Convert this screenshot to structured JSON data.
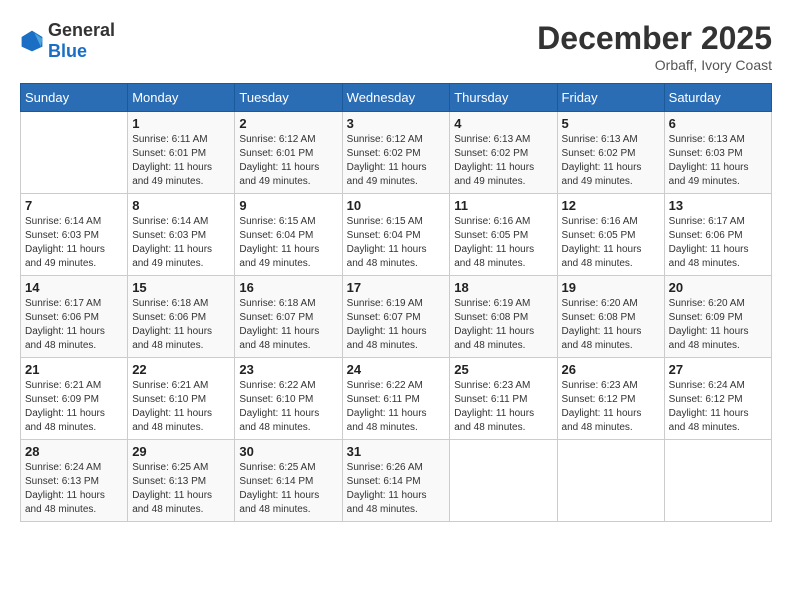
{
  "header": {
    "logo_general": "General",
    "logo_blue": "Blue",
    "month_title": "December 2025",
    "location": "Orbaff, Ivory Coast"
  },
  "days_of_week": [
    "Sunday",
    "Monday",
    "Tuesday",
    "Wednesday",
    "Thursday",
    "Friday",
    "Saturday"
  ],
  "weeks": [
    [
      {
        "day": "",
        "sunrise": "",
        "sunset": "",
        "daylight": ""
      },
      {
        "day": "1",
        "sunrise": "Sunrise: 6:11 AM",
        "sunset": "Sunset: 6:01 PM",
        "daylight": "Daylight: 11 hours and 49 minutes."
      },
      {
        "day": "2",
        "sunrise": "Sunrise: 6:12 AM",
        "sunset": "Sunset: 6:01 PM",
        "daylight": "Daylight: 11 hours and 49 minutes."
      },
      {
        "day": "3",
        "sunrise": "Sunrise: 6:12 AM",
        "sunset": "Sunset: 6:02 PM",
        "daylight": "Daylight: 11 hours and 49 minutes."
      },
      {
        "day": "4",
        "sunrise": "Sunrise: 6:13 AM",
        "sunset": "Sunset: 6:02 PM",
        "daylight": "Daylight: 11 hours and 49 minutes."
      },
      {
        "day": "5",
        "sunrise": "Sunrise: 6:13 AM",
        "sunset": "Sunset: 6:02 PM",
        "daylight": "Daylight: 11 hours and 49 minutes."
      },
      {
        "day": "6",
        "sunrise": "Sunrise: 6:13 AM",
        "sunset": "Sunset: 6:03 PM",
        "daylight": "Daylight: 11 hours and 49 minutes."
      }
    ],
    [
      {
        "day": "7",
        "sunrise": "Sunrise: 6:14 AM",
        "sunset": "Sunset: 6:03 PM",
        "daylight": "Daylight: 11 hours and 49 minutes."
      },
      {
        "day": "8",
        "sunrise": "Sunrise: 6:14 AM",
        "sunset": "Sunset: 6:03 PM",
        "daylight": "Daylight: 11 hours and 49 minutes."
      },
      {
        "day": "9",
        "sunrise": "Sunrise: 6:15 AM",
        "sunset": "Sunset: 6:04 PM",
        "daylight": "Daylight: 11 hours and 49 minutes."
      },
      {
        "day": "10",
        "sunrise": "Sunrise: 6:15 AM",
        "sunset": "Sunset: 6:04 PM",
        "daylight": "Daylight: 11 hours and 48 minutes."
      },
      {
        "day": "11",
        "sunrise": "Sunrise: 6:16 AM",
        "sunset": "Sunset: 6:05 PM",
        "daylight": "Daylight: 11 hours and 48 minutes."
      },
      {
        "day": "12",
        "sunrise": "Sunrise: 6:16 AM",
        "sunset": "Sunset: 6:05 PM",
        "daylight": "Daylight: 11 hours and 48 minutes."
      },
      {
        "day": "13",
        "sunrise": "Sunrise: 6:17 AM",
        "sunset": "Sunset: 6:06 PM",
        "daylight": "Daylight: 11 hours and 48 minutes."
      }
    ],
    [
      {
        "day": "14",
        "sunrise": "Sunrise: 6:17 AM",
        "sunset": "Sunset: 6:06 PM",
        "daylight": "Daylight: 11 hours and 48 minutes."
      },
      {
        "day": "15",
        "sunrise": "Sunrise: 6:18 AM",
        "sunset": "Sunset: 6:06 PM",
        "daylight": "Daylight: 11 hours and 48 minutes."
      },
      {
        "day": "16",
        "sunrise": "Sunrise: 6:18 AM",
        "sunset": "Sunset: 6:07 PM",
        "daylight": "Daylight: 11 hours and 48 minutes."
      },
      {
        "day": "17",
        "sunrise": "Sunrise: 6:19 AM",
        "sunset": "Sunset: 6:07 PM",
        "daylight": "Daylight: 11 hours and 48 minutes."
      },
      {
        "day": "18",
        "sunrise": "Sunrise: 6:19 AM",
        "sunset": "Sunset: 6:08 PM",
        "daylight": "Daylight: 11 hours and 48 minutes."
      },
      {
        "day": "19",
        "sunrise": "Sunrise: 6:20 AM",
        "sunset": "Sunset: 6:08 PM",
        "daylight": "Daylight: 11 hours and 48 minutes."
      },
      {
        "day": "20",
        "sunrise": "Sunrise: 6:20 AM",
        "sunset": "Sunset: 6:09 PM",
        "daylight": "Daylight: 11 hours and 48 minutes."
      }
    ],
    [
      {
        "day": "21",
        "sunrise": "Sunrise: 6:21 AM",
        "sunset": "Sunset: 6:09 PM",
        "daylight": "Daylight: 11 hours and 48 minutes."
      },
      {
        "day": "22",
        "sunrise": "Sunrise: 6:21 AM",
        "sunset": "Sunset: 6:10 PM",
        "daylight": "Daylight: 11 hours and 48 minutes."
      },
      {
        "day": "23",
        "sunrise": "Sunrise: 6:22 AM",
        "sunset": "Sunset: 6:10 PM",
        "daylight": "Daylight: 11 hours and 48 minutes."
      },
      {
        "day": "24",
        "sunrise": "Sunrise: 6:22 AM",
        "sunset": "Sunset: 6:11 PM",
        "daylight": "Daylight: 11 hours and 48 minutes."
      },
      {
        "day": "25",
        "sunrise": "Sunrise: 6:23 AM",
        "sunset": "Sunset: 6:11 PM",
        "daylight": "Daylight: 11 hours and 48 minutes."
      },
      {
        "day": "26",
        "sunrise": "Sunrise: 6:23 AM",
        "sunset": "Sunset: 6:12 PM",
        "daylight": "Daylight: 11 hours and 48 minutes."
      },
      {
        "day": "27",
        "sunrise": "Sunrise: 6:24 AM",
        "sunset": "Sunset: 6:12 PM",
        "daylight": "Daylight: 11 hours and 48 minutes."
      }
    ],
    [
      {
        "day": "28",
        "sunrise": "Sunrise: 6:24 AM",
        "sunset": "Sunset: 6:13 PM",
        "daylight": "Daylight: 11 hours and 48 minutes."
      },
      {
        "day": "29",
        "sunrise": "Sunrise: 6:25 AM",
        "sunset": "Sunset: 6:13 PM",
        "daylight": "Daylight: 11 hours and 48 minutes."
      },
      {
        "day": "30",
        "sunrise": "Sunrise: 6:25 AM",
        "sunset": "Sunset: 6:14 PM",
        "daylight": "Daylight: 11 hours and 48 minutes."
      },
      {
        "day": "31",
        "sunrise": "Sunrise: 6:26 AM",
        "sunset": "Sunset: 6:14 PM",
        "daylight": "Daylight: 11 hours and 48 minutes."
      },
      {
        "day": "",
        "sunrise": "",
        "sunset": "",
        "daylight": ""
      },
      {
        "day": "",
        "sunrise": "",
        "sunset": "",
        "daylight": ""
      },
      {
        "day": "",
        "sunrise": "",
        "sunset": "",
        "daylight": ""
      }
    ]
  ]
}
